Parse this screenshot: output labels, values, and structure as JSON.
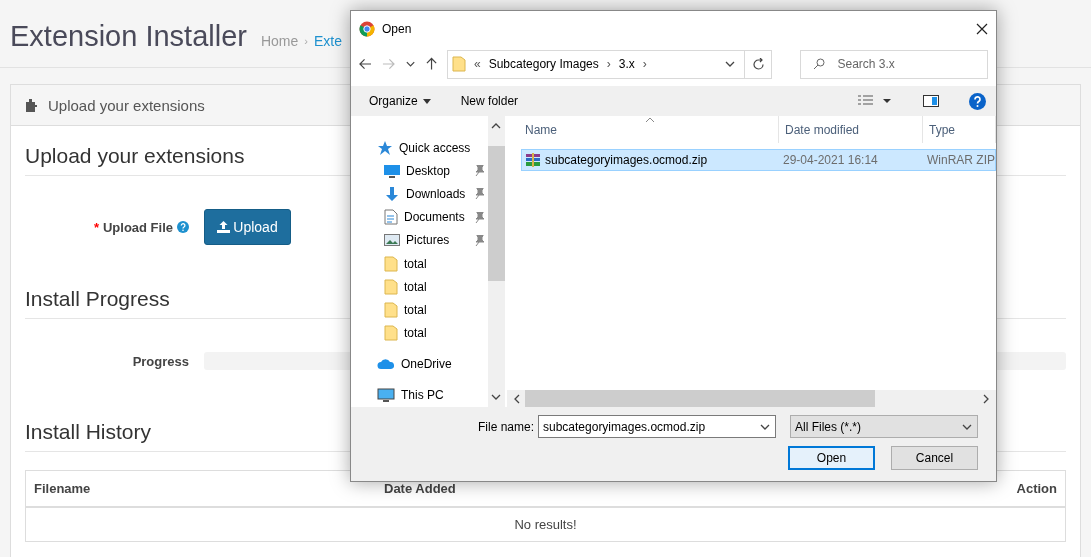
{
  "page": {
    "title": "Extension Installer",
    "breadcrumb_separator": "›",
    "breadcrumb": [
      {
        "label": "Home"
      },
      {
        "label": "Exte"
      }
    ]
  },
  "panel": {
    "heading": "Upload your extensions",
    "sections": [
      {
        "kind": "upload",
        "title": "Upload your extensions",
        "label": "Upload File",
        "required_mark": "*",
        "button": "Upload"
      },
      {
        "kind": "progress",
        "title": "Install Progress",
        "label": "Progress",
        "level": 0
      },
      {
        "kind": "history",
        "title": "Install History",
        "columns": [
          "Filename",
          "Date Added",
          "Action"
        ],
        "empty_text": "No results!"
      }
    ]
  },
  "dialog": {
    "title": "Open",
    "path": [
      "«",
      "Subcategory Images",
      "›",
      "3.x",
      "›"
    ],
    "search_placeholder": "Search 3.x",
    "toolbar": [
      "Organize",
      "New folder"
    ],
    "nav": [
      {
        "kind": "quick",
        "label": "Quick access",
        "pinned": false
      },
      {
        "kind": "desktop",
        "label": "Desktop",
        "pinned": true
      },
      {
        "kind": "downloads",
        "label": "Downloads",
        "pinned": true
      },
      {
        "kind": "documents",
        "label": "Documents",
        "pinned": true
      },
      {
        "kind": "pictures",
        "label": "Pictures",
        "pinned": true
      },
      {
        "kind": "folder",
        "label": "total",
        "pinned": false
      },
      {
        "kind": "folder",
        "label": "total",
        "pinned": false
      },
      {
        "kind": "folder",
        "label": "total",
        "pinned": false
      },
      {
        "kind": "folder",
        "label": "total",
        "pinned": false
      },
      {
        "kind": "onedrive",
        "label": "OneDrive",
        "pinned": false
      },
      {
        "kind": "pc",
        "label": "This PC",
        "pinned": false
      }
    ],
    "columns": [
      "Name",
      "Date modified",
      "Type"
    ],
    "files": [
      {
        "name": "subcategoryimages.ocmod.zip",
        "date": "29-04-2021 16:14",
        "type": "WinRAR ZIP",
        "selected": true
      }
    ],
    "file_name_label": "File name:",
    "file_name": "subcategoryimages.ocmod.zip",
    "filter": "All Files (*.*)",
    "buttons": [
      {
        "label": "Open",
        "default": true
      },
      {
        "label": "Cancel",
        "default": false
      }
    ]
  }
}
